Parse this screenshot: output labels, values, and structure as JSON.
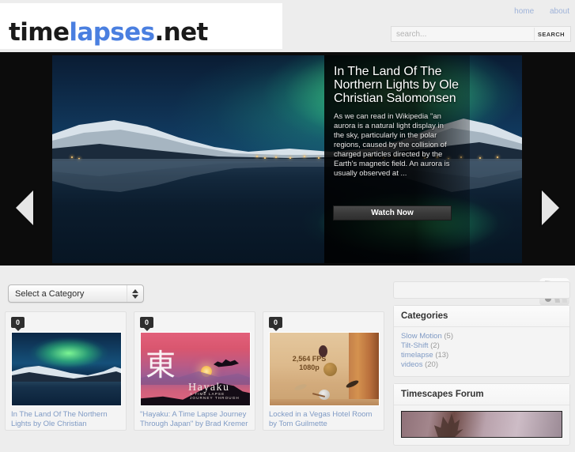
{
  "site": {
    "logo_part1": "time",
    "logo_part2": "lapses",
    "logo_part3": ".net",
    "accent_color": "#4a7fe0",
    "link_color": "#7f9ac4"
  },
  "topnav": {
    "items": [
      {
        "label": "home"
      },
      {
        "label": "about"
      }
    ]
  },
  "search": {
    "placeholder": "search...",
    "value": "",
    "button_label": "SEARCH",
    "icon": "search-icon"
  },
  "hero": {
    "title": "In The Land Of The Northern Lights by Ole Christian Salomonsen",
    "description": "As we can read in Wikipedia \"an aurora is a natural light display in the sky, particularly in the polar regions, caused by the collision of charged particles directed by the Earth's magnetic field. An aurora is usually observed at ...",
    "button_label": "Watch Now",
    "prev_icon": "chevron-left-icon",
    "next_icon": "chevron-right-icon"
  },
  "toolbar": {
    "category_select_label": "Select a Category",
    "stepper_icon": "updown-stepper-icon",
    "rss_icon": "rss-feed-icon"
  },
  "posts": [
    {
      "comment_count": "0",
      "title": "In The Land Of The Northern Lights by Ole Christian",
      "thumb_alt": "aurora-over-mountains-thumbnail"
    },
    {
      "comment_count": "0",
      "title": "\"Hayaku: A Time Lapse Journey Through Japan\" by Brad Kremer",
      "thumb_alt": "hayaku-poster-thumbnail",
      "poster_title": "Hayaku",
      "poster_subtitle": "A TIME LAPSE JOURNEY THROUGH",
      "poster_kanji": "東"
    },
    {
      "comment_count": "0",
      "title": "Locked in a Vegas Hotel Room by Tom Guilmette",
      "thumb_alt": "vegas-hotel-room-thumbnail",
      "overlay_text": "2,564 FPS\n1080p"
    }
  ],
  "sidebar": {
    "widgets": [
      {
        "title": "Categories",
        "items": [
          {
            "label": "Slow Motion",
            "count": "(5)"
          },
          {
            "label": "Tilt-Shift",
            "count": "(2)"
          },
          {
            "label": "timelapse",
            "count": "(13)"
          },
          {
            "label": "videos",
            "count": "(20)"
          }
        ]
      },
      {
        "title": "Timescapes Forum"
      }
    ]
  }
}
